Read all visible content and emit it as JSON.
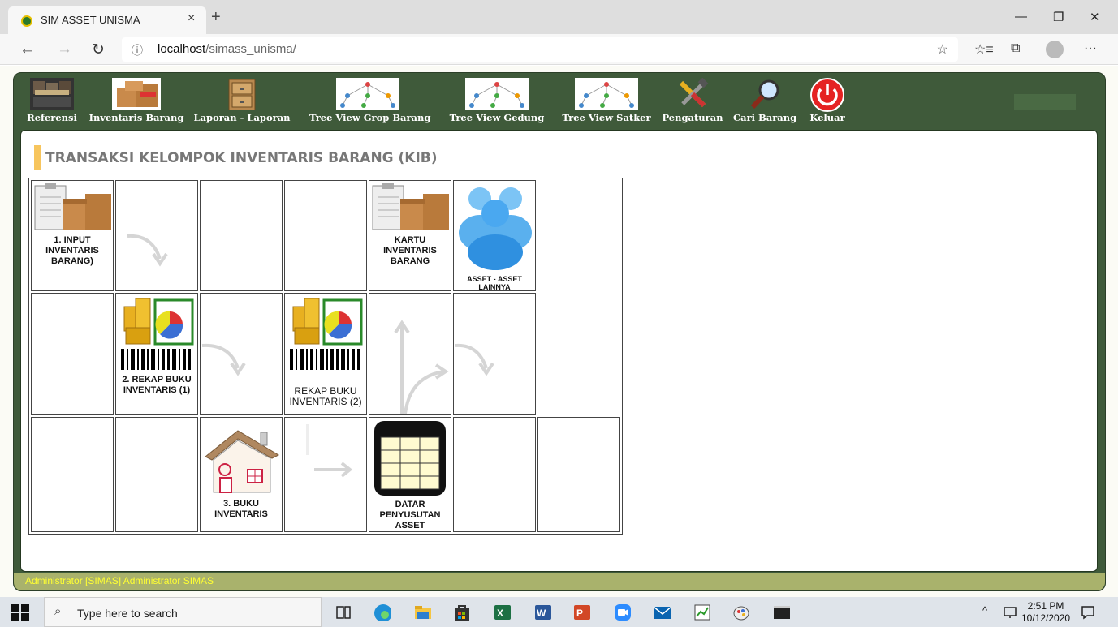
{
  "browser": {
    "tab_title": "SIM ASSET UNISMA",
    "close_tab": "×",
    "new_tab": "+",
    "url_host": "localhost",
    "url_path": "/simass_unisma/",
    "info_glyph": "ⓘ",
    "back": "←",
    "forward": "→",
    "refresh": "↻",
    "favorite_star": "☆",
    "favorites": "☆≡",
    "collections": "⧉",
    "more": "···",
    "minimize": "—",
    "restore": "❐",
    "close": "✕"
  },
  "menu": {
    "items": [
      {
        "label": "Referensi",
        "icon": "inventory-management-icon"
      },
      {
        "label": "Inventaris Barang",
        "icon": "boxes-icon"
      },
      {
        "label": "Laporan - Laporan",
        "icon": "cabinet-icon"
      },
      {
        "label": "Tree View Grop Barang",
        "icon": "tree-diagram-icon"
      },
      {
        "label": "Tree View Gedung",
        "icon": "tree-diagram-icon"
      },
      {
        "label": "Tree View Satker",
        "icon": "tree-diagram-icon"
      },
      {
        "label": "Pengaturan",
        "icon": "tools-icon"
      },
      {
        "label": "Cari Barang",
        "icon": "magnifier-icon"
      },
      {
        "label": "Keluar",
        "icon": "power-icon"
      }
    ]
  },
  "main": {
    "title": "TRANSAKSI KELOMPOK INVENTARIS BARANG (KIB)",
    "cells": {
      "input": "1. INPUT INVENTARIS BARANG)",
      "kartu": "KARTU INVENTARIS BARANG",
      "asset_lain": "ASSET - ASSET LAINNYA",
      "rekap1": "2. REKAP BUKU INVENTARIS (1)",
      "rekap2": "REKAP BUKU INVENTARIS (2)",
      "buku": "3. BUKU INVENTARIS",
      "datar": "DATAR PENYUSUTAN ASSET"
    }
  },
  "footer": {
    "user": "Administrator [SIMAS] Administrator SIMAS"
  },
  "taskbar": {
    "search_placeholder": "Type here to search",
    "time": "2:51 PM",
    "date": "10/12/2020",
    "tray_up": "^"
  },
  "colors": {
    "frame_green": "#3f5a3a",
    "footer_olive": "#a9b26c",
    "footer_text": "#ffff33",
    "title_accent": "#f7c55d"
  }
}
